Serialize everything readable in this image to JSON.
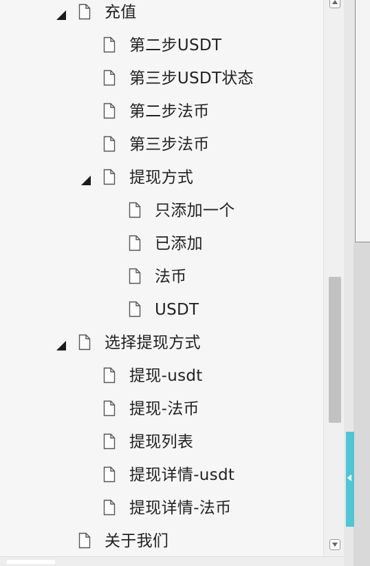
{
  "tree": [
    {
      "label": "充值",
      "level": 1,
      "expanded": true
    },
    {
      "label": "第二步USDT",
      "level": 2
    },
    {
      "label": "第三步USDT状态",
      "level": 2
    },
    {
      "label": "第二步法币",
      "level": 2
    },
    {
      "label": "第三步法币",
      "level": 2
    },
    {
      "label": "提现方式",
      "level": 2,
      "expanded": true
    },
    {
      "label": "只添加一个",
      "level": 3
    },
    {
      "label": "已添加",
      "level": 3
    },
    {
      "label": "法币",
      "level": 3
    },
    {
      "label": "USDT",
      "level": 3
    },
    {
      "label": "选择提现方式",
      "level": 1,
      "expanded": true
    },
    {
      "label": "提现-usdt",
      "level": 2
    },
    {
      "label": "提现-法币",
      "level": 2
    },
    {
      "label": "提现列表",
      "level": 2
    },
    {
      "label": "提现详情-usdt",
      "level": 2
    },
    {
      "label": "提现详情-法币",
      "level": 2
    },
    {
      "label": "关于我们",
      "level": 1
    }
  ],
  "icons": {
    "page": "file-icon",
    "expanded": "expanded-triangle-icon",
    "scroll_up": "scroll-up-icon",
    "scroll_down": "scroll-down-icon",
    "collapse": "collapse-panel-icon"
  },
  "colors": {
    "accent": "#4ec6d3",
    "text": "#222222",
    "background": "#f6f6f6"
  }
}
